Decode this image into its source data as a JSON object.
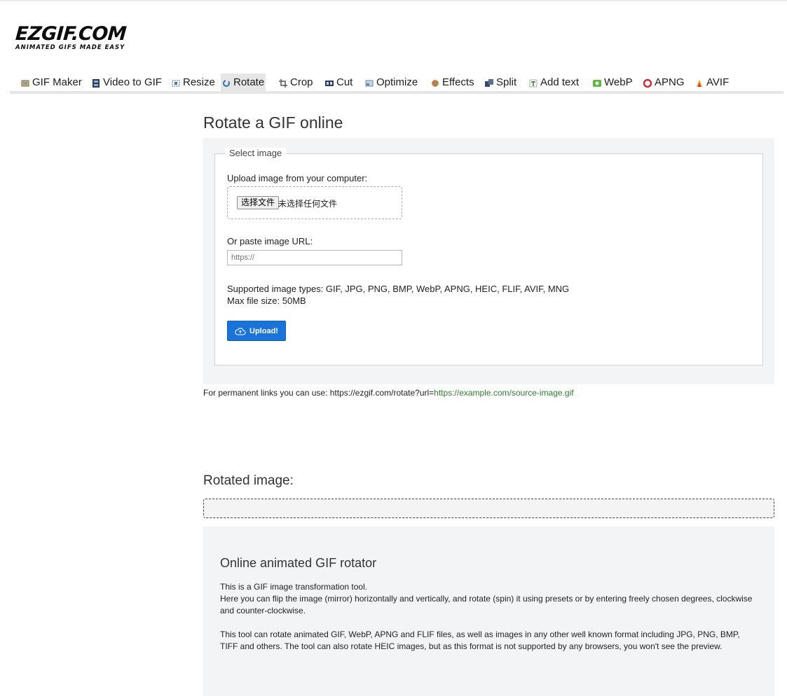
{
  "logo": {
    "text": "EZGIF.COM",
    "tagline": "ANIMATED GIFS MADE EASY"
  },
  "nav": {
    "items": [
      {
        "label": "GIF Maker",
        "icon": "gif-maker-icon",
        "active": false
      },
      {
        "label": "Video to GIF",
        "icon": "film-icon",
        "active": false
      },
      {
        "label": "Resize",
        "icon": "resize-icon",
        "active": false
      },
      {
        "label": "Rotate",
        "icon": "rotate-icon",
        "active": true
      },
      {
        "label": "Crop",
        "icon": "crop-icon",
        "active": false
      },
      {
        "label": "Cut",
        "icon": "cut-icon",
        "active": false
      },
      {
        "label": "Optimize",
        "icon": "optimize-icon",
        "active": false
      },
      {
        "label": "Effects",
        "icon": "effects-icon",
        "active": false
      },
      {
        "label": "Split",
        "icon": "split-icon",
        "active": false
      },
      {
        "label": "Add text",
        "icon": "add-text-icon",
        "active": false
      },
      {
        "label": "WebP",
        "icon": "webp-icon",
        "active": false
      },
      {
        "label": "APNG",
        "icon": "apng-icon",
        "active": false
      },
      {
        "label": "AVIF",
        "icon": "avif-icon",
        "active": false
      }
    ]
  },
  "page": {
    "title": "Rotate a GIF online"
  },
  "upload": {
    "legend": "Select image",
    "upload_label": "Upload image from your computer:",
    "file_button": "选择文件",
    "file_status": "未选择任何文件",
    "url_label": "Or paste image URL:",
    "url_placeholder": "https://",
    "types_line": "Supported image types: GIF, JPG, PNG, BMP, WebP, APNG, HEIC, FLIF, AVIF, MNG",
    "max_size": "Max file size: 50MB",
    "button_label": "Upload!"
  },
  "permanent": {
    "prefix": "For permanent links you can use: https://ezgif.com/rotate?url=",
    "example": "https://example.com/source-image.gif"
  },
  "result": {
    "title": "Rotated image:"
  },
  "info": {
    "title": "Online animated GIF rotator",
    "p1_line1": "This is a GIF image transformation tool.",
    "p1_line2": "Here you can flip the image (mirror) horizontally and vertically, and rotate (spin) it using presets or by entering freely chosen degrees, clockwise and counter-clockwise.",
    "p2": "This tool can rotate animated GIF, WebP, APNG and FLIF files, as well as images in any other well known format including JPG, PNG, BMP, TIFF and others. The tool can also rotate HEIC images, but as this format is not supported by any browsers, you won't see the preview."
  },
  "colors": {
    "upload_button": "#1a73d9",
    "link": "#2e7d32",
    "panel_bg": "#f3f4f6"
  }
}
